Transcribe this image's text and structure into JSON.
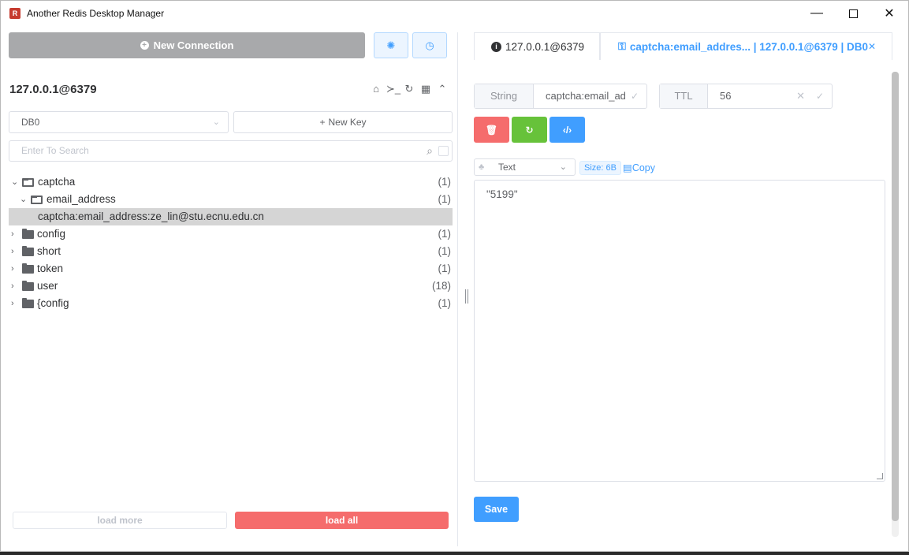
{
  "window": {
    "app_icon_glyph": "R",
    "title": "Another Redis Desktop Manager",
    "minimize": "—",
    "close": "✕"
  },
  "left": {
    "new_connection_label": "New Connection",
    "connection_name": "127.0.0.1@6379",
    "db_value": "DB0",
    "new_key_label": "New Key",
    "search_placeholder": "Enter To Search",
    "tree": [
      {
        "label": "captcha",
        "count": "(1)",
        "expanded": true,
        "level": 0
      },
      {
        "label": "email_address",
        "count": "(1)",
        "expanded": true,
        "level": 1
      },
      {
        "label": "captcha:email_address:ze_lin@stu.ecnu.edu.cn",
        "count": "",
        "level": 2,
        "selected": true
      },
      {
        "label": "config",
        "count": "(1)",
        "expanded": false,
        "level": 0
      },
      {
        "label": "short",
        "count": "(1)",
        "expanded": false,
        "level": 0
      },
      {
        "label": "token",
        "count": "(1)",
        "expanded": false,
        "level": 0
      },
      {
        "label": "user",
        "count": "(18)",
        "expanded": false,
        "level": 0
      },
      {
        "label": "{config",
        "count": "(1)",
        "expanded": false,
        "level": 0
      }
    ],
    "load_more_label": "load more",
    "load_all_label": "load all"
  },
  "right": {
    "tab_info_label": "127.0.0.1@6379",
    "tab_key_label": "captcha:email_addres... | 127.0.0.1@6379 | DB0",
    "type_label": "String",
    "key_name": "captcha:email_ad",
    "ttl_label": "TTL",
    "ttl_value": "56",
    "format_value": "Text",
    "size_tag": "Size: 6B",
    "copy_label": "Copy",
    "value": "\"5199\"",
    "save_label": "Save"
  },
  "colors": {
    "primary": "#409eff",
    "danger": "#f56c6c",
    "success": "#67c23a",
    "disabled": "#a8a9ab"
  }
}
